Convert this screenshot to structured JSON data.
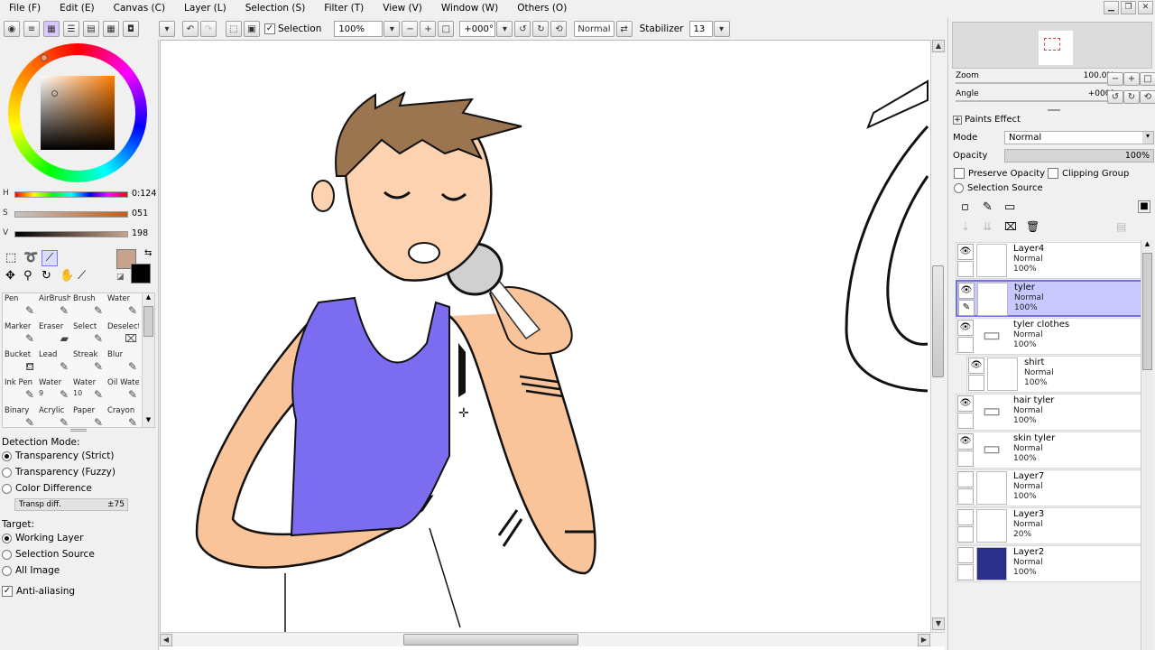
{
  "menu": {
    "items": [
      "File (F)",
      "Edit (E)",
      "Canvas (C)",
      "Layer (L)",
      "Selection (S)",
      "Filter (T)",
      "View (V)",
      "Window (W)",
      "Others (O)"
    ]
  },
  "toolbar": {
    "selection_label": "Selection",
    "zoom_value": "100%",
    "rotation_value": "+000°",
    "blend_value": "Normal",
    "stabilizer_label": "Stabilizer",
    "stabilizer_value": "13"
  },
  "color": {
    "h_label": "H",
    "h_value": "0:124",
    "s_label": "S",
    "s_value": "051",
    "v_label": "V",
    "v_value": "198",
    "primary": "#c9a48c",
    "secondary": "#000000"
  },
  "tools": [
    {
      "label": "Pen",
      "num": ""
    },
    {
      "label": "AirBrush",
      "num": ""
    },
    {
      "label": "Brush",
      "num": ""
    },
    {
      "label": "Water",
      "num": ""
    },
    {
      "label": "Marker",
      "num": ""
    },
    {
      "label": "Eraser",
      "num": ""
    },
    {
      "label": "Select",
      "num": ""
    },
    {
      "label": "Deselect",
      "num": ""
    },
    {
      "label": "Bucket",
      "num": ""
    },
    {
      "label": "Lead",
      "num": ""
    },
    {
      "label": "Streak",
      "num": ""
    },
    {
      "label": "Blur",
      "num": ""
    },
    {
      "label": "Ink Pen",
      "num": ""
    },
    {
      "label": "Water",
      "num": "9"
    },
    {
      "label": "Water",
      "num": "10"
    },
    {
      "label": "Oil Wate",
      "num": ""
    },
    {
      "label": "Binary",
      "num": ""
    },
    {
      "label": "Acrylic",
      "num": ""
    },
    {
      "label": "Paper",
      "num": ""
    },
    {
      "label": "Crayon",
      "num": ""
    }
  ],
  "options": {
    "detection_label": "Detection Mode:",
    "detection_items": [
      "Transparency (Strict)",
      "Transparency (Fuzzy)",
      "Color Difference"
    ],
    "transp_label": "Transp diff.",
    "transp_value": "±75",
    "target_label": "Target:",
    "target_items": [
      "Working Layer",
      "Selection Source",
      "All Image"
    ],
    "antialias_label": "Anti-aliasing"
  },
  "navigator": {
    "zoom_label": "Zoom",
    "zoom_value": "100.0%",
    "angle_label": "Angle",
    "angle_value": "+000§"
  },
  "layer_props": {
    "paints_effect_label": "Paints Effect",
    "mode_label": "Mode",
    "mode_value": "Normal",
    "opacity_label": "Opacity",
    "opacity_value": "100%",
    "preserve_label": "Preserve Opacity",
    "clipping_label": "Clipping Group",
    "selection_source_label": "Selection Source"
  },
  "layers": [
    {
      "name": "Layer4",
      "mode": "Normal",
      "opacity": "100%"
    },
    {
      "name": "tyler",
      "mode": "Normal",
      "opacity": "100%"
    },
    {
      "name": "tyler clothes",
      "mode": "Normal",
      "opacity": "100%"
    },
    {
      "name": "shirt",
      "mode": "Normal",
      "opacity": "100%"
    },
    {
      "name": "hair tyler",
      "mode": "Normal",
      "opacity": "100%"
    },
    {
      "name": "skin tyler",
      "mode": "Normal",
      "opacity": "100%"
    },
    {
      "name": "Layer7",
      "mode": "Normal",
      "opacity": "100%"
    },
    {
      "name": "Layer3",
      "mode": "Normal",
      "opacity": "20%"
    },
    {
      "name": "Layer2",
      "mode": "Normal",
      "opacity": "100%"
    }
  ]
}
